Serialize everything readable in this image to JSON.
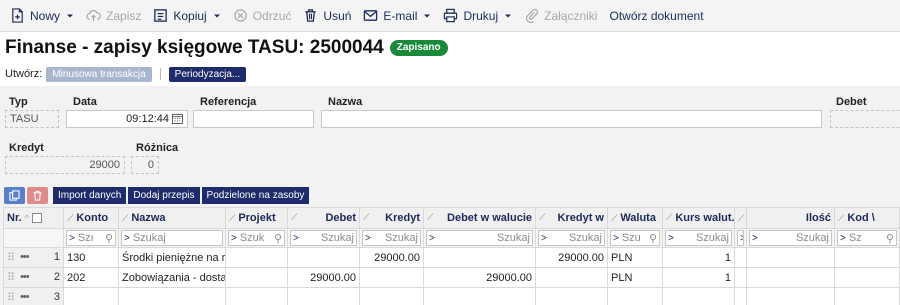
{
  "toolbar": {
    "new": "Nowy",
    "save": "Zapisz",
    "copy": "Kopiuj",
    "discard": "Odrzuć",
    "delete": "Usuń",
    "email": "E-mail",
    "print": "Drukuj",
    "attachments": "Załączniki",
    "open_document": "Otwórz dokument"
  },
  "header": {
    "title": "Finanse - zapisy księgowe TASU: 2500044",
    "status_badge": "Zapisano",
    "create_label": "Utwórz:",
    "negative_tx": "Minusowa transakcja",
    "periodization": "Periodyzacja..."
  },
  "fields": {
    "type_label": "Typ",
    "type_value": "TASU",
    "date_label": "Data",
    "date_value": "09:12:44",
    "reference_label": "Referencja",
    "reference_value": "",
    "name_label": "Nazwa",
    "name_value": "",
    "debit_label": "Debet",
    "debit_value": "",
    "credit_label": "Kredyt",
    "credit_value": "29000",
    "difference_label": "Różnica",
    "difference_value": "0"
  },
  "actions": {
    "import": "Import danych",
    "add_rule": "Dodaj przepis",
    "split": "Podzielone na zasoby"
  },
  "grid": {
    "columns": [
      "Nr.",
      "Konto",
      "Nazwa",
      "Projekt",
      "Debet",
      "Kredyt",
      "Debet w walucie",
      "Kredyt w",
      "Waluta",
      "Kurs walut.",
      "",
      "Ilość",
      "Kod \\"
    ],
    "filter_operator": ">",
    "filter_placeholder_short": "Szı",
    "filter_placeholder": "Szukaj",
    "filter_placeholder_projekt": "Szuk",
    "filter_placeholder_waluta": "Szu",
    "filter_placeholder_kod": "Sz",
    "rows": [
      {
        "nr": "1",
        "konto": "130",
        "nazwa": "Środki pieniężne na r",
        "projekt": "",
        "debet": "",
        "kredyt": "29000.00",
        "debet_w": "",
        "kredyt_w": "29000.00",
        "waluta": "PLN",
        "kurs": "1",
        "blank": "",
        "ilosc": "",
        "kod": ""
      },
      {
        "nr": "2",
        "konto": "202",
        "nazwa": "Zobowiązania - dosta",
        "projekt": "",
        "debet": "29000.00",
        "kredyt": "",
        "debet_w": "29000.00",
        "kredyt_w": "",
        "waluta": "PLN",
        "kurs": "1",
        "blank": "",
        "ilosc": "",
        "kod": ""
      },
      {
        "nr": "3",
        "konto": "",
        "nazwa": "",
        "projekt": "",
        "debet": "",
        "kredyt": "",
        "debet_w": "",
        "kredyt_w": "",
        "waluta": "",
        "kurs": "",
        "blank": "",
        "ilosc": "",
        "kod": ""
      }
    ]
  },
  "colors": {
    "navy": "#1f2b6b",
    "saved_green": "#1a8a3a",
    "delete_red": "#e08a8a",
    "copy_blue": "#5b7ec9"
  }
}
